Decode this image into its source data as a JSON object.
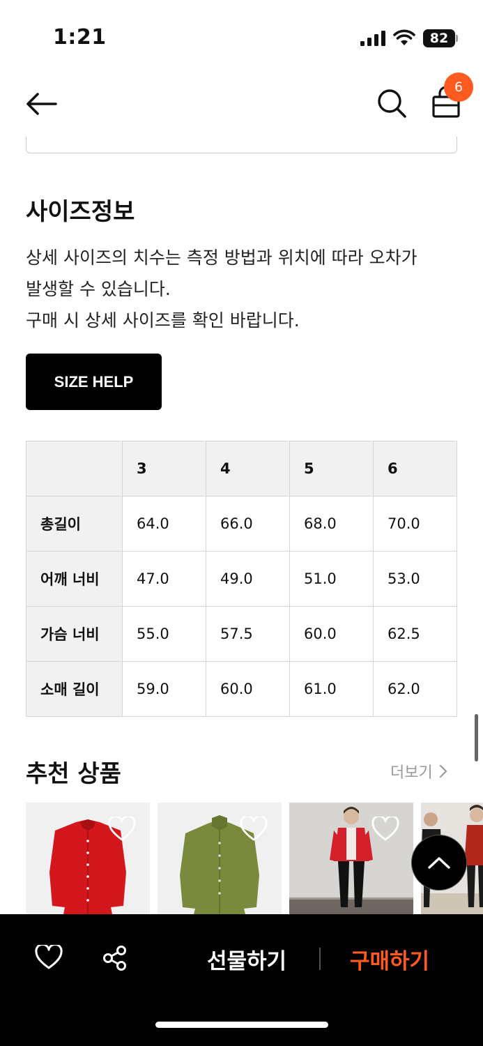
{
  "status": {
    "time": "1:21",
    "battery": "82"
  },
  "nav": {
    "cart_count": "6"
  },
  "size_info": {
    "title": "사이즈정보",
    "description_lines": [
      "상세 사이즈의 치수는 측정 방법과 위치에 따라 오차가",
      "발생할 수 있습니다.",
      "구매 시 상세 사이즈를 확인 바랍니다."
    ],
    "help_button": "SIZE HELP",
    "table": {
      "headers": [
        "",
        "3",
        "4",
        "5",
        "6"
      ],
      "rows": [
        {
          "label": "총길이",
          "values": [
            "64.0",
            "66.0",
            "68.0",
            "70.0"
          ]
        },
        {
          "label": "어깨 너비",
          "values": [
            "47.0",
            "49.0",
            "51.0",
            "53.0"
          ]
        },
        {
          "label": "가슴 너비",
          "values": [
            "55.0",
            "57.5",
            "60.0",
            "62.5"
          ]
        },
        {
          "label": "소매 길이",
          "values": [
            "59.0",
            "60.0",
            "61.0",
            "62.0"
          ]
        }
      ]
    }
  },
  "recommend": {
    "title": "추천 상품",
    "more_label": "더보기"
  },
  "bottom_bar": {
    "gift_label": "선물하기",
    "buy_label": "구매하기"
  },
  "colors": {
    "accent": "#ff5a1f",
    "bar_bg": "#000000",
    "table_header": "#f1f1f1"
  },
  "icons": [
    "back-arrow-icon",
    "search-icon",
    "shopping-bag-icon",
    "heart-icon",
    "share-icon",
    "chevron-up-icon",
    "chevron-right-icon"
  ]
}
